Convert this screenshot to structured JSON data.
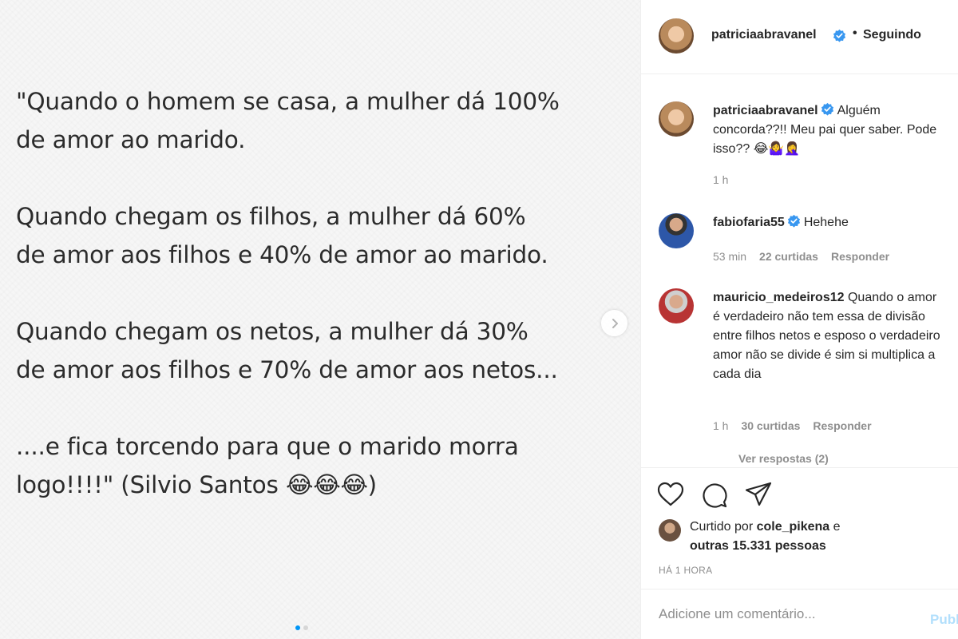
{
  "post": {
    "quote_paragraphs": [
      "\"Quando o homem se casa, a mulher dá 100%\nde amor ao marido.",
      "Quando chegam os filhos, a mulher dá 60%\nde amor aos filhos e 40% de amor ao marido.",
      "Quando chegam os netos, a mulher dá 30%\nde amor aos filhos e 70% de amor aos netos...",
      "....e fica torcendo para que o marido morra\nlogo!!!!\" (Silvio Santos 😂😂😂)"
    ]
  },
  "header": {
    "username": "patriciaabravanel",
    "separator": "•",
    "follow_status": "Seguindo"
  },
  "comments": [
    {
      "username": "patriciaabravanel",
      "verified": true,
      "text": "Alguém concorda??!! Meu pai quer saber. Pode isso?? 😂🤷‍♀️🤦‍♀️",
      "time": "1 h"
    },
    {
      "username": "fabiofaria55",
      "verified": true,
      "text": "Hehehe",
      "time": "53 min",
      "likes": "22 curtidas",
      "reply_label": "Responder"
    },
    {
      "username": "mauricio_medeiros12",
      "verified": false,
      "text": "Quando o amor é verdadeiro não tem essa de divisão entre filhos netos e esposo o verdadeiro amor não se divide é sim si multiplica a cada dia",
      "time": "1 h",
      "likes": "30 curtidas",
      "reply_label": "Responder",
      "view_replies": "Ver respostas (2)"
    }
  ],
  "likes": {
    "prefix": "Curtido por ",
    "first_user": "cole_pikena",
    "middle": " e ",
    "others": "outras 15.331 pessoas"
  },
  "time_ago": "HÁ 1 HORA",
  "add_comment": {
    "placeholder": "Adicione um comentário...",
    "post_label": "Publicar"
  },
  "colors": {
    "verified": "#3897f0",
    "post_disabled": "#b2dffc",
    "muted": "#8e8e8e"
  },
  "icons": [
    "chevron-right-icon",
    "heart-icon",
    "comment-icon",
    "share-icon",
    "verified-icon"
  ]
}
